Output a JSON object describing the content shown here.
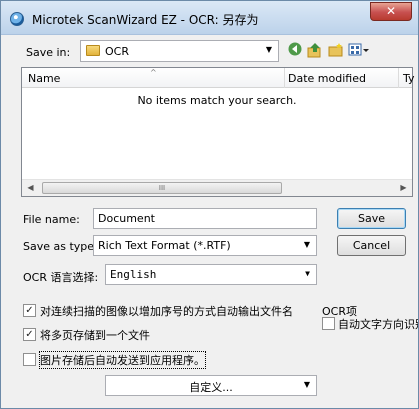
{
  "window": {
    "title": "Microtek ScanWizard EZ - OCR: 另存为",
    "close_glyph": "✕"
  },
  "save_in": {
    "label": "Save in:",
    "value": "OCR"
  },
  "toolbar": {
    "back_icon": "back-icon",
    "up_icon": "up-folder-icon",
    "new_folder_icon": "new-folder-icon",
    "views_icon": "views-menu-icon"
  },
  "file_list": {
    "columns": [
      "Name",
      "Date modified",
      "Ty"
    ],
    "empty_message": "No items match your search.",
    "scroll_grip": "III"
  },
  "file_name": {
    "label": "File name:",
    "value": "Document"
  },
  "save_as_type": {
    "label": "Save as type:",
    "value": "Rich Text Format (*.RTF)"
  },
  "ocr_language": {
    "label": "OCR 语言选择:",
    "value": "English"
  },
  "buttons": {
    "save": "Save",
    "cancel": "Cancel"
  },
  "options": {
    "auto_filename": {
      "label": "对连续扫描的图像以增加序号的方式自动输出文件名",
      "checked": true
    },
    "multipage": {
      "label": "将多页存储到一个文件",
      "checked": true
    },
    "send_to_app": {
      "label": "图片存储后自动发送到应用程序。",
      "checked": false
    },
    "custom": "自定义..."
  },
  "ocr_group": {
    "title": "OCR项",
    "auto_orient": {
      "label": "自动文字方向识别",
      "checked": false
    }
  }
}
